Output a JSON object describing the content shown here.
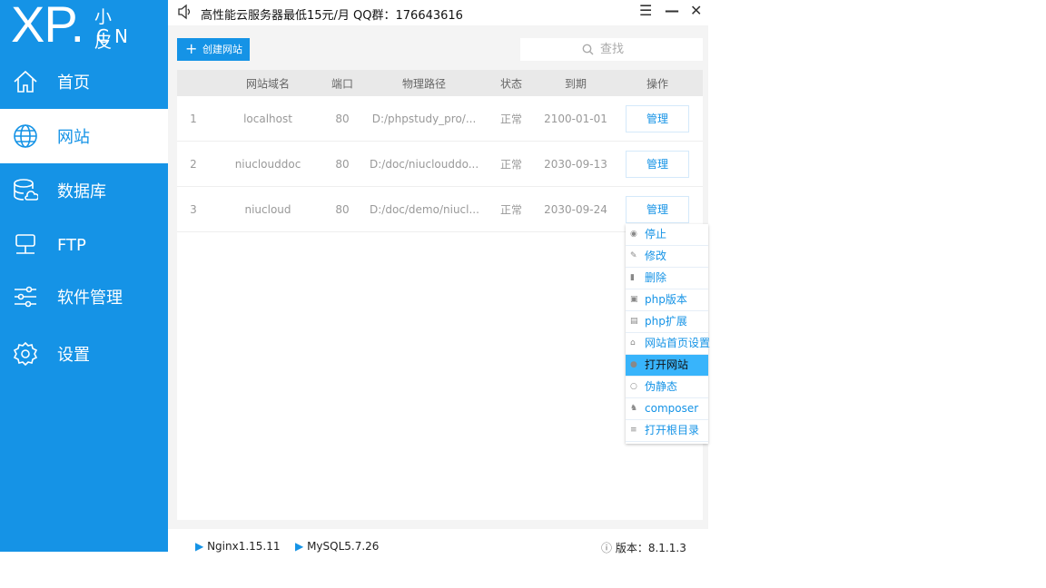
{
  "logo": {
    "xp": "XP.",
    "cn_top": "小皮",
    "cn_bottom": "CN"
  },
  "nav": [
    {
      "label": "首页",
      "icon": "home-icon"
    },
    {
      "label": "网站",
      "icon": "globe-icon"
    },
    {
      "label": "数据库",
      "icon": "database-icon"
    },
    {
      "label": "FTP",
      "icon": "ftp-icon"
    },
    {
      "label": "软件管理",
      "icon": "sliders-icon"
    },
    {
      "label": "设置",
      "icon": "gear-icon"
    }
  ],
  "topbar": {
    "notice": "高性能云服务器最低15元/月  QQ群：176643616",
    "menu": "☰",
    "minimize": "—",
    "close": "✕"
  },
  "toolbar": {
    "create_label": "创建网站",
    "search_placeholder": "查找"
  },
  "table": {
    "headers": [
      "网站域名",
      "端口",
      "物理路径",
      "状态",
      "到期",
      "操作"
    ],
    "rows": [
      {
        "no": "1",
        "domain": "localhost",
        "port": "80",
        "path": "D:/phpstudy_pro/...",
        "status": "正常",
        "expire": "2100-01-01",
        "action": "管理"
      },
      {
        "no": "2",
        "domain": "niuclouddoc",
        "port": "80",
        "path": "D:/doc/niuclouddo...",
        "status": "正常",
        "expire": "2030-09-13",
        "action": "管理"
      },
      {
        "no": "3",
        "domain": "niucloud",
        "port": "80",
        "path": "D:/doc/demo/niucl...",
        "status": "正常",
        "expire": "2030-09-24",
        "action": "管理"
      }
    ]
  },
  "context_menu": [
    "停止",
    "修改",
    "删除",
    "php版本",
    "php扩展",
    "网站首页设置",
    "打开网站",
    "伪静态",
    "composer",
    "打开根目录"
  ],
  "footer": {
    "nginx": "Nginx1.15.11",
    "mysql": "MySQL5.7.26",
    "version": "版本：8.1.1.3"
  }
}
